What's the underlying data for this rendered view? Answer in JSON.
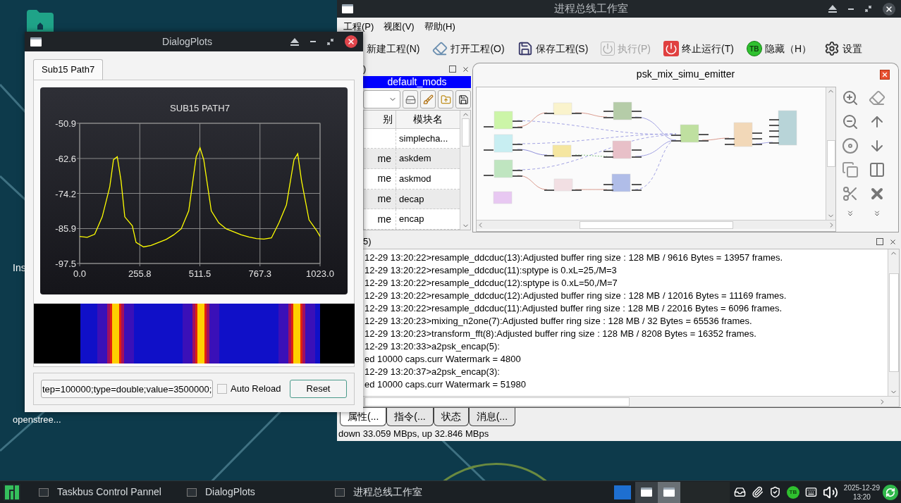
{
  "desktop": {
    "icons": [
      {
        "label": "Ins"
      },
      {
        "label": "openstree..."
      }
    ]
  },
  "main_window": {
    "title": "进程总线工作室",
    "menu": [
      "工程(P)",
      "视图(V)",
      "帮助(H)"
    ],
    "toolbar": [
      {
        "kind": "new",
        "label": "新建工程(N)",
        "disabled": false
      },
      {
        "kind": "open",
        "label": "打开工程(O)",
        "disabled": false
      },
      {
        "kind": "save",
        "label": "保存工程(S)",
        "disabled": false
      },
      {
        "kind": "run",
        "label": "执行(P)",
        "disabled": true
      },
      {
        "kind": "stop",
        "label": "终止运行(T)",
        "disabled": false
      },
      {
        "kind": "hide",
        "badge": "TB",
        "label": "隐藏（H）",
        "disabled": false
      },
      {
        "kind": "settings",
        "label": "设置",
        "disabled": false
      }
    ],
    "module_panel": {
      "title": ")",
      "library": "default_mods",
      "columns": [
        "别",
        "模块名"
      ],
      "rows": [
        {
          "name": "simplecha..."
        },
        {
          "type": "me",
          "name": "askdem"
        },
        {
          "type": "me",
          "name": "askmod"
        },
        {
          "type": "me",
          "name": "decap"
        },
        {
          "type": "me",
          "name": "encap"
        }
      ]
    },
    "project_tab": {
      "title": "psk_mix_simu_emitter"
    },
    "log_panel": {
      "title": "5)",
      "lines": [
        "12-29 13:20:22>resample_ddcduc(13):Adjusted buffer ring size : 128 MB / 9616 Bytes = 13957 frames.",
        "12-29 13:20:22>resample_ddcduc(11):sptype is 0.xL=25,/M=3",
        "12-29 13:20:22>resample_ddcduc(12):sptype is 0.xL=50,/M=7",
        "12-29 13:20:22>resample_ddcduc(12):Adjusted buffer ring size : 128 MB / 12016 Bytes = 11169 frames.",
        "12-29 13:20:22>resample_ddcduc(11):Adjusted buffer ring size : 128 MB / 22016 Bytes = 6096 frames.",
        "12-29 13:20:23>mixing_n2one(7):Adjusted buffer ring size : 128 MB / 32 Bytes = 65536 frames.",
        "12-29 13:20:23>transform_fft(8):Adjusted buffer ring size : 128 MB / 8208 Bytes = 16352 frames.",
        "12-29 13:20:33>a2psk_encap(5):",
        "ed 10000 caps.curr Watermark = 4800",
        "12-29 13:20:37>a2psk_encap(3):",
        "ed 10000 caps.curr Watermark = 51980"
      ]
    },
    "bottom_tabs": [
      {
        "label": "属性(...",
        "selected": true
      },
      {
        "label": "指令(...",
        "selected": false
      },
      {
        "label": "状态",
        "selected": false
      },
      {
        "label": "消息(...",
        "selected": false
      }
    ],
    "status_bar": "down 33.059 MBps, up 32.846 MBps"
  },
  "dialog": {
    "title": "DialogPlots",
    "tabs": [
      {
        "label": "Sub15 Path7",
        "selected": true
      }
    ],
    "chart_data": {
      "type": "line",
      "title": "SUB15 PATH7",
      "xlim": [
        0,
        1023
      ],
      "ylim": [
        -97.5,
        -50.9
      ],
      "xticks": [
        {
          "value": 0,
          "label": "0.0"
        },
        {
          "value": 255.8,
          "label": "255.8"
        },
        {
          "value": 511.5,
          "label": "511.5"
        },
        {
          "value": 767.3,
          "label": "767.3"
        },
        {
          "value": 1023,
          "label": "1023.0"
        }
      ],
      "yticks": [
        {
          "value": -50.9,
          "label": "-50.9"
        },
        {
          "value": -62.6,
          "label": "-62.6"
        },
        {
          "value": -74.2,
          "label": "-74.2"
        },
        {
          "value": -85.9,
          "label": "-85.9"
        },
        {
          "value": -97.5,
          "label": "-97.5"
        }
      ],
      "x": [
        0,
        32,
        64,
        96,
        128,
        144,
        160,
        176,
        192,
        224,
        240,
        272,
        304,
        336,
        368,
        400,
        432,
        464,
        496,
        512,
        528,
        560,
        592,
        624,
        656,
        688,
        720,
        752,
        784,
        816,
        848,
        880,
        912,
        928,
        944,
        976,
        1008,
        1023
      ],
      "grid": true,
      "series": [
        {
          "color": "#ffff00",
          "values": [
            -88.5,
            -88.8,
            -87.8,
            -82,
            -72,
            -63,
            -62,
            -70,
            -82,
            -85,
            -90.5,
            -92,
            -91.5,
            -90.5,
            -89.5,
            -88,
            -86,
            -80,
            -62,
            -59,
            -63,
            -80,
            -84,
            -86,
            -87,
            -88,
            -88.7,
            -89.2,
            -89.4,
            -89,
            -84,
            -78,
            -63,
            -61,
            -70,
            -83,
            -86.5,
            -88.5
          ]
        }
      ]
    },
    "params_field": {
      "value": "tep=100000;type=double;value=3500000;"
    },
    "auto_reload": {
      "label": "Auto Reload",
      "checked": false
    },
    "reset_button": "Reset"
  },
  "taskbar": {
    "tasks": [
      {
        "label": "Taskbus Control Pannel"
      },
      {
        "label": "DialogPlots"
      },
      {
        "label": "进程总线工作室"
      }
    ],
    "switcher": [
      {
        "selected": false
      },
      {
        "selected": true
      }
    ],
    "tray_badge": "TB",
    "date": "2025-12-29",
    "time": "13:20"
  }
}
